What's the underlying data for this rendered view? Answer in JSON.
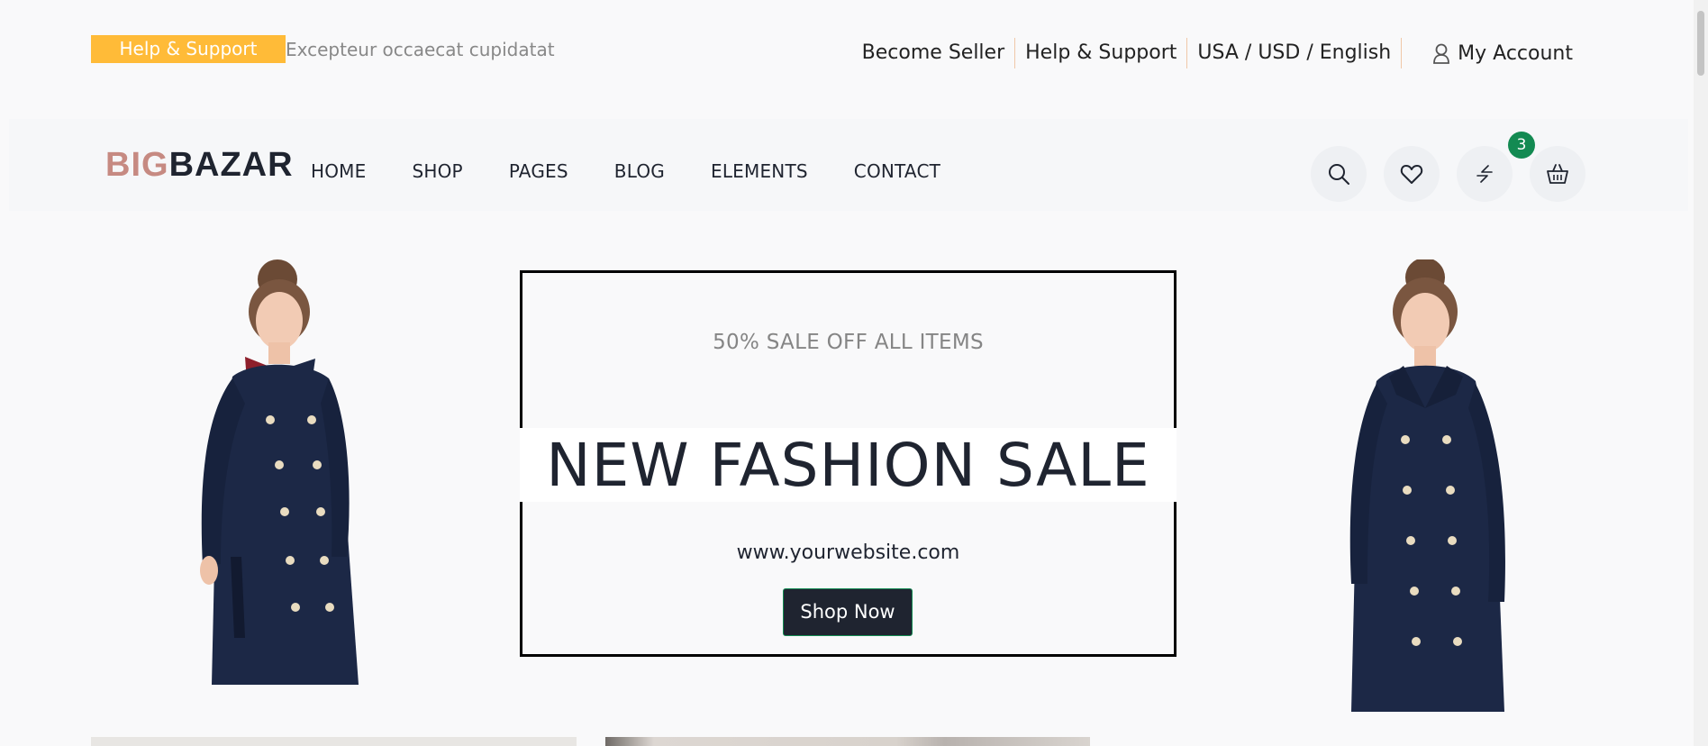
{
  "topbar": {
    "help_badge": "Help & Support",
    "tagline": "Excepteur occaecat cupidatat",
    "links": [
      "Become Seller",
      "Help & Support",
      "USA / USD / English"
    ],
    "account": "My Account"
  },
  "header": {
    "logo_part1": "BIG",
    "logo_part2": "BAZAR",
    "nav": [
      "HOME",
      "SHOP",
      "PAGES",
      "BLOG",
      "ELEMENTS",
      "CONTACT"
    ],
    "icons": [
      "search-icon",
      "heart-icon",
      "compare-icon",
      "basket-icon"
    ],
    "cart_count": "3"
  },
  "hero": {
    "subtitle": "50% SALE OFF ALL ITEMS",
    "title": "NEW FASHION SALE",
    "url": "www.yourwebsite.com",
    "button": "Shop Now"
  },
  "colors": {
    "accent": "#ffbb38",
    "badge": "#138a52",
    "dark": "#1f2430",
    "logo_big": "#c68a82"
  }
}
